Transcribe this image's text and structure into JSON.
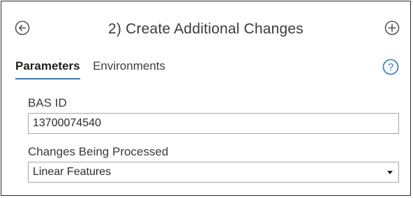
{
  "header": {
    "title": "2) Create Additional Changes",
    "back_icon": "back-arrow-circle-icon",
    "add_icon": "plus-circle-icon"
  },
  "tabs": [
    {
      "label": "Parameters",
      "active": true
    },
    {
      "label": "Environments",
      "active": false
    }
  ],
  "help": {
    "icon": "help-question-icon",
    "symbol": "?"
  },
  "fields": {
    "bas_id": {
      "label": "BAS ID",
      "value": "13700074540"
    },
    "changes": {
      "label": "Changes Being Processed",
      "value": "Linear Features"
    }
  },
  "colors": {
    "accent": "#2a7ac7",
    "border": "#a8a8a8",
    "text": "#3b3b3b"
  }
}
